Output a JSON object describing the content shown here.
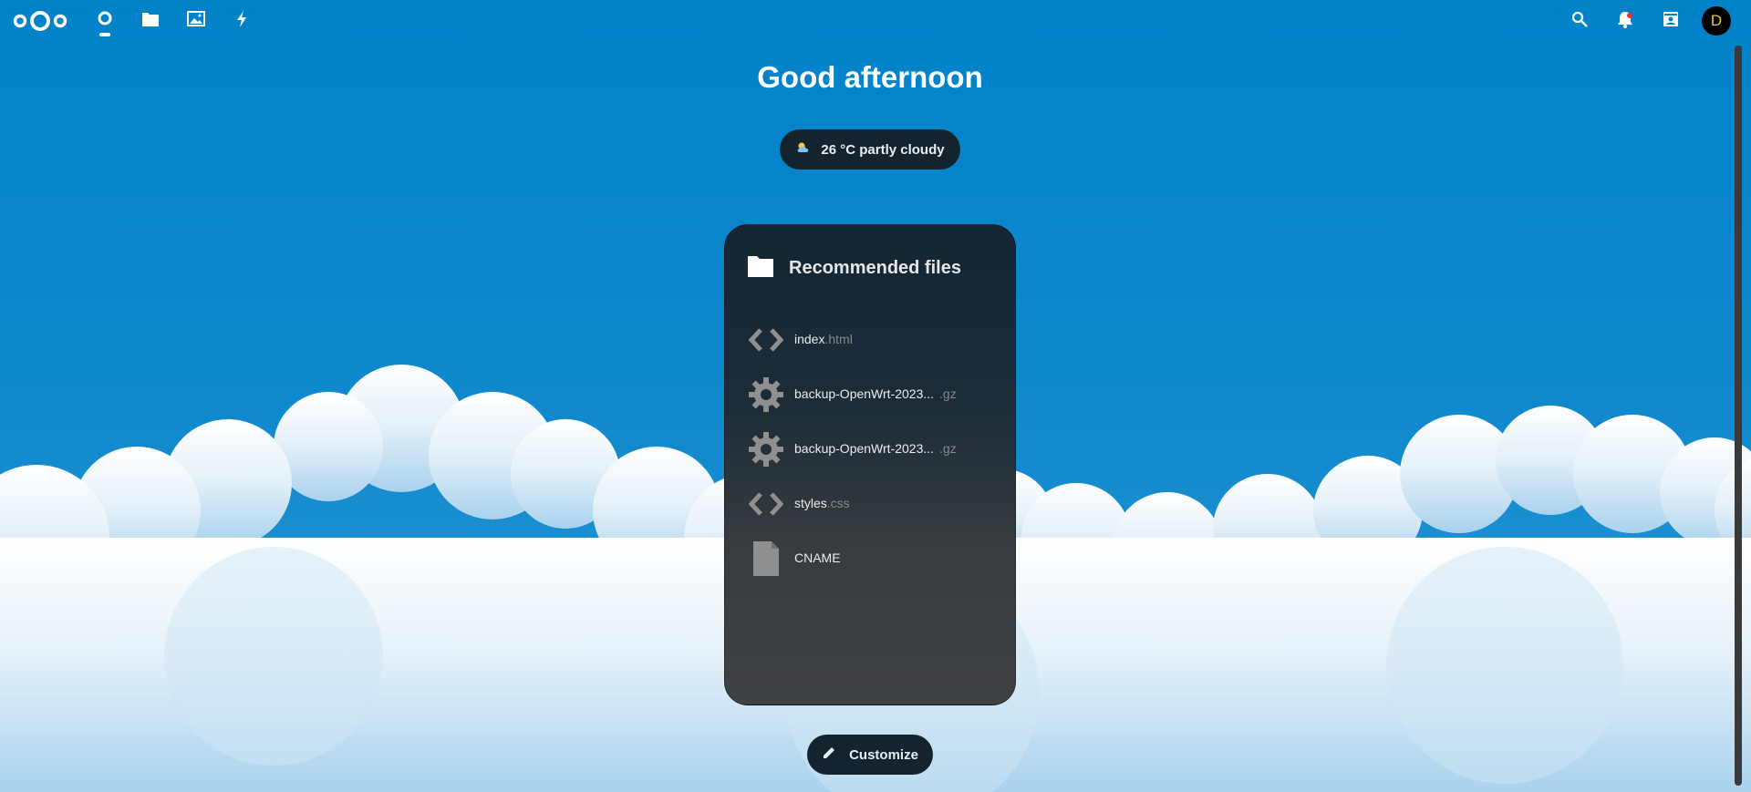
{
  "nav": {
    "logo_icon": "nextcloud-logo",
    "apps": [
      {
        "name": "dashboard",
        "icon": "dashboard-icon",
        "active": true
      },
      {
        "name": "files",
        "icon": "folder-icon"
      },
      {
        "name": "photos",
        "icon": "image-icon"
      },
      {
        "name": "activity",
        "icon": "lightning-icon"
      }
    ],
    "right": [
      "search-icon",
      "bell-icon",
      "contacts-icon"
    ],
    "avatar_letter": "D"
  },
  "greeting": "Good afternoon",
  "weather": {
    "icon": "partly-cloudy-icon",
    "text": "26 °C partly cloudy"
  },
  "recommended": {
    "title": "Recommended files",
    "files": [
      {
        "icon": "code-icon",
        "name": "index",
        "ext": ".html"
      },
      {
        "icon": "gear-icon",
        "name": "backup-OpenWrt-2023...",
        "ext": ".gz"
      },
      {
        "icon": "gear-icon",
        "name": "backup-OpenWrt-2023...",
        "ext": ".gz"
      },
      {
        "icon": "code-icon",
        "name": "styles",
        "ext": ".css"
      },
      {
        "icon": "file-icon",
        "name": "CNAME",
        "ext": ""
      }
    ]
  },
  "customize_label": "Customize",
  "colors": {
    "primary": "#0082c9",
    "panel_dark": "#15232f",
    "avatar_text": "#e9c432"
  }
}
